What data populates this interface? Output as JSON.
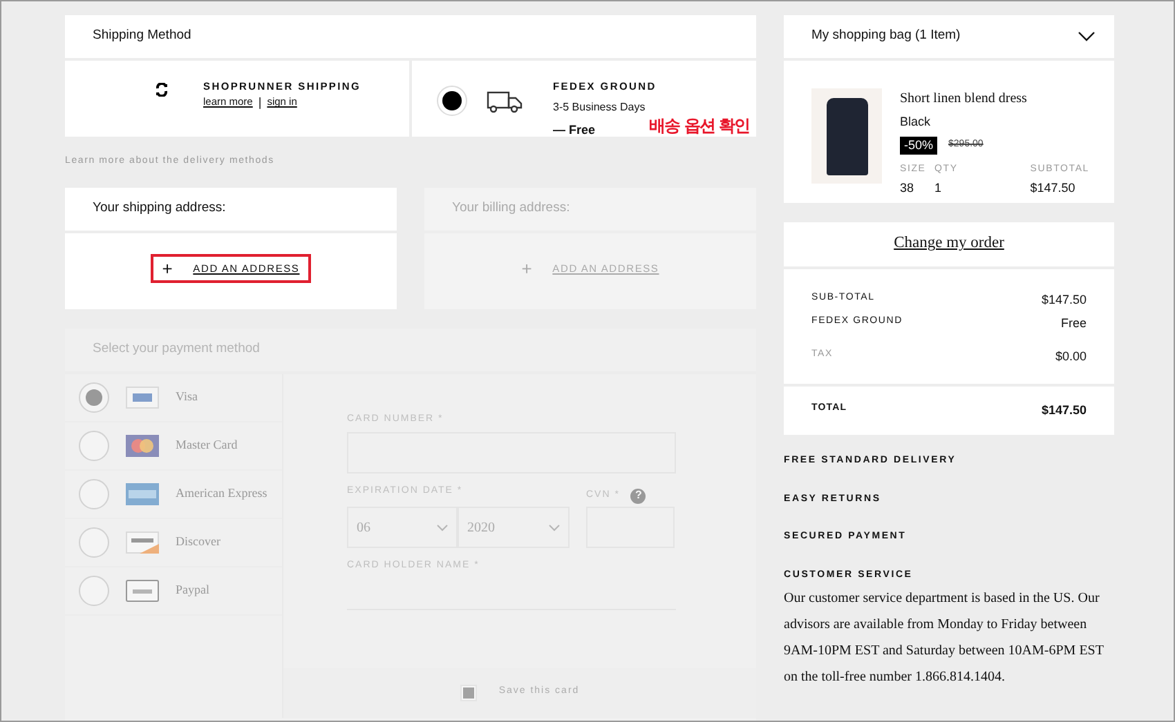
{
  "shipping_method": {
    "title": "Shipping Method",
    "annotation": "배송 옵션 확인",
    "options": [
      {
        "kind": "shoprunner",
        "name": "SHOPRUNNER SHIPPING",
        "links": [
          "learn more",
          "sign in"
        ],
        "separator": "|",
        "selected": false
      },
      {
        "kind": "fedex",
        "name": "FEDEX GROUND",
        "detail": "3-5 Business Days",
        "price": "— Free",
        "selected": true
      }
    ]
  },
  "delivery_link": "Learn more about the delivery methods",
  "addresses": [
    {
      "title": "Your shipping address:",
      "icon": "+",
      "action": "ADD AN ADDRESS",
      "disabled": false,
      "highlighted": true
    },
    {
      "title": "Your billing address:",
      "icon": "+",
      "action": "ADD AN ADDRESS",
      "disabled": true,
      "highlighted": false
    }
  ],
  "payment": {
    "title": "Select your payment method",
    "disabled": true,
    "methods": [
      {
        "kind": "visa",
        "name": "Visa",
        "selected": true
      },
      {
        "kind": "mastercard",
        "name": "Master Card",
        "selected": false
      },
      {
        "kind": "amex",
        "name": "American Express",
        "selected": false
      },
      {
        "kind": "discover",
        "name": "Discover",
        "selected": false
      },
      {
        "kind": "paypal",
        "name": "Paypal",
        "selected": false
      }
    ],
    "card_number_label": "CARD NUMBER *",
    "expiration_label": "EXPIRATION DATE *",
    "month": "06",
    "year": "2020",
    "cvn_label": "CVN *",
    "cvn_help": "?",
    "holder_label": "CARD HOLDER NAME *",
    "save_card": {
      "label": "Save this card",
      "checked": true
    }
  },
  "bag": {
    "title": "My shopping bag (1 Item)",
    "item": {
      "name": "Short linen blend dress",
      "variant": "Black",
      "discount": "-50%",
      "old_price": "$295.00",
      "size_label": "SIZE",
      "qty_label": "QTY",
      "subtotal_label": "SUBTOTAL",
      "size": "38",
      "qty": "1",
      "subtotal": "$147.50"
    }
  },
  "order": {
    "change_link": "Change my order",
    "lines": [
      {
        "label": "SUB-TOTAL",
        "value": "$147.50",
        "muted": false
      },
      {
        "label": "FEDEX GROUND",
        "value": "Free",
        "muted": false
      },
      {
        "label": "TAX",
        "value": "$0.00",
        "muted": true
      }
    ],
    "total": {
      "label": "TOTAL",
      "value": "$147.50"
    }
  },
  "features": [
    "FREE STANDARD DELIVERY",
    "EASY RETURNS",
    "SECURED PAYMENT"
  ],
  "customer_service": {
    "title": "CUSTOMER SERVICE",
    "text": "Our customer service department is based in the US. Our advisors are available from Monday to Friday between 9AM-10PM EST and Saturday between 10AM-6PM EST on the toll-free number 1.866.814.1404."
  }
}
